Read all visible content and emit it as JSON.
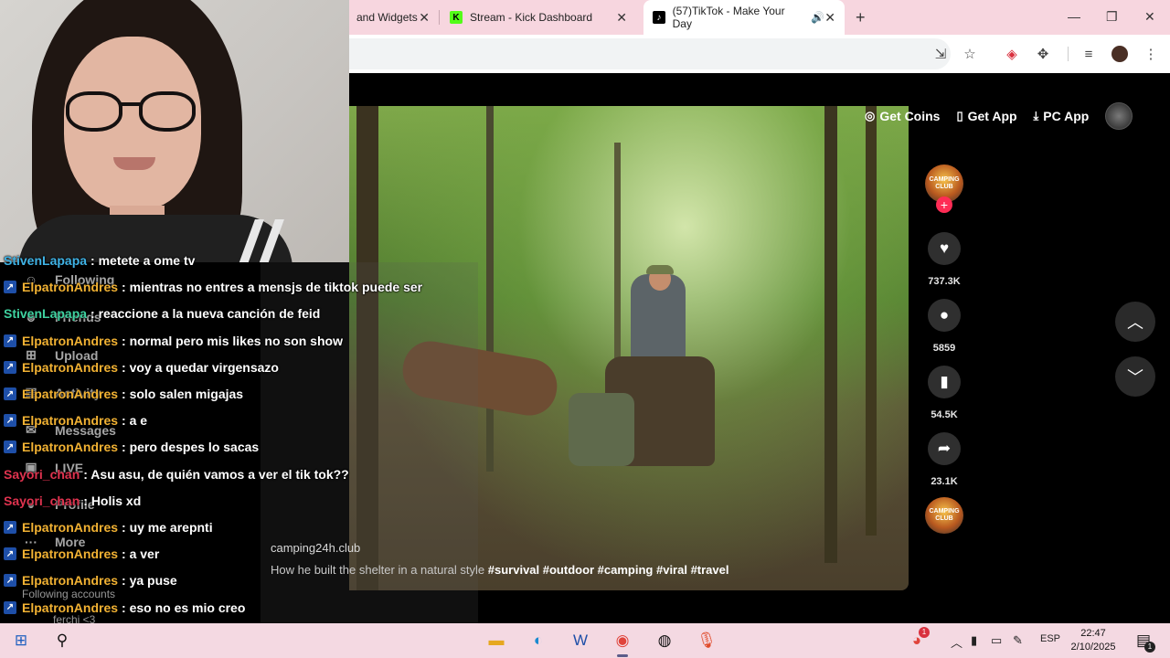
{
  "browser": {
    "tabs": [
      {
        "label": "and Widgets",
        "active": false
      },
      {
        "label": "Stream - Kick Dashboard",
        "active": false
      },
      {
        "label": "(57)TikTok - Make Your Day",
        "active": true
      }
    ],
    "new_tab": "+",
    "window": {
      "minimize": "—",
      "restore": "❐",
      "close": "✕"
    }
  },
  "tiktok": {
    "topbar": {
      "get_coins": "Get Coins",
      "get_app": "Get App",
      "pc_app": "PC App"
    },
    "creator_badge": "CAMPING CLUB",
    "likes": "737.3K",
    "comments": "5859",
    "saves": "54.5K",
    "shares": "23.1K",
    "video": {
      "username": "camping24h.club",
      "description": "How he built the shelter in a natural style",
      "hashtags": "#survival  #outdoor  #camping  #viral  #travel"
    },
    "sidenav": {
      "following": "Following",
      "friends": "Friends",
      "upload": "Upload",
      "activity": "Activity",
      "messages": "Messages",
      "live": "LIVE",
      "profile": "Profile",
      "more": "More",
      "following_accounts": "Following accounts",
      "account_1": "ferchi <3"
    }
  },
  "chat": {
    "messages": [
      {
        "user": "StivenLapapa",
        "text": ": metete a ome tv",
        "user_color": "#3fb3e6",
        "badge": false
      },
      {
        "user": "ElpatronAndres",
        "text": ": mientras no entres a mensjs de tiktok puede ser",
        "user_color": "#f2b233",
        "badge": true
      },
      {
        "user": "StivenLapapa",
        "text": ": reaccione a la nueva canción de feid",
        "user_color": "#3fd2a0",
        "badge": false
      },
      {
        "user": "ElpatronAndres",
        "text": ": normal pero mis likes no son show",
        "user_color": "#f2b233",
        "badge": true
      },
      {
        "user": "ElpatronAndres",
        "text": ": voy a quedar virgensazo",
        "user_color": "#f2b233",
        "badge": true
      },
      {
        "user": "ElpatronAndres",
        "text": ": solo salen migajas",
        "user_color": "#f2b233",
        "badge": true
      },
      {
        "user": "ElpatronAndres",
        "text": ": a e",
        "user_color": "#f2b233",
        "badge": true
      },
      {
        "user": "ElpatronAndres",
        "text": ": pero despes lo sacas",
        "user_color": "#f2b233",
        "badge": true
      },
      {
        "user": "Sayori_chan",
        "text": ": Asu asu, de quién vamos a ver el tik tok??",
        "user_color": "#e0334f",
        "badge": false
      },
      {
        "user": "Sayori_chan",
        "text": ": Holis xd",
        "user_color": "#e0334f",
        "badge": false
      },
      {
        "user": "ElpatronAndres",
        "text": ": uy me arepnti",
        "user_color": "#f2b233",
        "badge": true
      },
      {
        "user": "ElpatronAndres",
        "text": ": a ver",
        "user_color": "#f2b233",
        "badge": true
      },
      {
        "user": "ElpatronAndres",
        "text": ": ya puse",
        "user_color": "#f2b233",
        "badge": true
      },
      {
        "user": "ElpatronAndres",
        "text": ": eso no es mio creo",
        "user_color": "#f2b233",
        "badge": true
      }
    ]
  },
  "taskbar": {
    "language": "ESP",
    "time": "22:47",
    "date": "2/10/2025",
    "notification_count": "1"
  }
}
